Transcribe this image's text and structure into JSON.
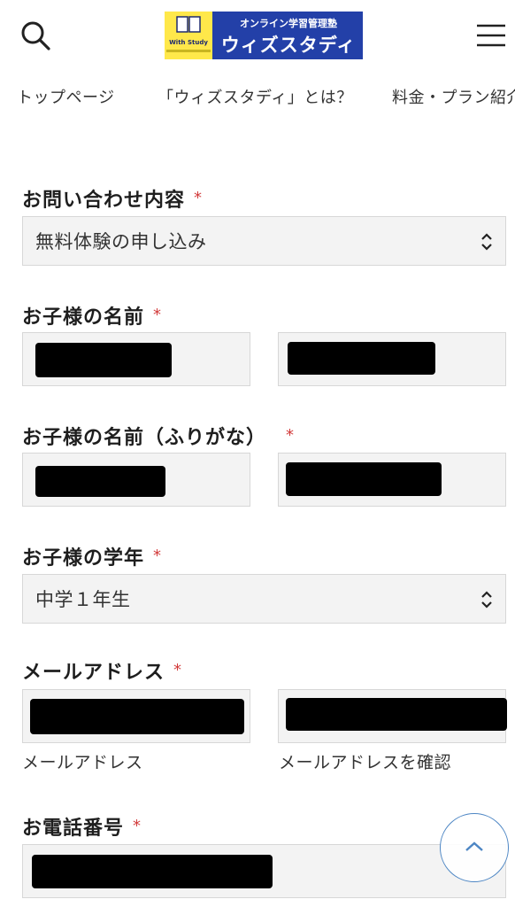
{
  "header": {
    "logo_badge_text": "With Study",
    "logo_tagline": "オンライン学習管理塾",
    "logo_name": "ウィズスタディ",
    "nav": [
      "トップページ",
      "「ウィズスタディ」とは？",
      "料金・プラン紹介"
    ]
  },
  "form": {
    "inquiry": {
      "label": "お問い合わせ内容",
      "required": "*",
      "selected": "無料体験の申し込み"
    },
    "child_name": {
      "label": "お子様の名前",
      "required": "*"
    },
    "child_name_kana": {
      "label": "お子様の名前（ふりがな）",
      "required": "*"
    },
    "grade": {
      "label": "お子様の学年",
      "required": "*",
      "selected": "中学１年生"
    },
    "email": {
      "label": "メールアドレス",
      "required": "*",
      "caption_1": "メールアドレス",
      "caption_2": "メールアドレスを確認"
    },
    "phone": {
      "label": "お電話番号",
      "required": "*"
    }
  },
  "colors": {
    "logo_bg": "#2340a8",
    "logo_badge": "#ffe84a",
    "required": "#d23b3b",
    "field_bg": "#f3f3f3",
    "scroll_button_border": "#4d86c4"
  }
}
